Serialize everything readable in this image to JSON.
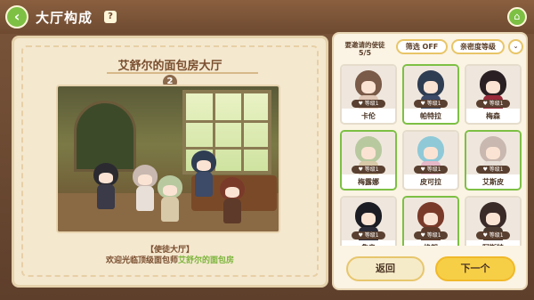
{
  "header": {
    "title": "大厅构成",
    "help_icon": "info-icon",
    "home_icon": "home-icon",
    "back_icon": "chevron-left-icon"
  },
  "left": {
    "hall_name": "艾舒尔的面包房大厅",
    "hall_number": "2",
    "caption_line1": "【使徒大厅】",
    "caption_prefix": "欢迎光临顶级面包师",
    "caption_highlight": "艾舒尔的面包房"
  },
  "right": {
    "invite_label": "要邀请的使徒",
    "invite_count": "5/5",
    "filter_label": "筛选 OFF",
    "sort_label": "亲密度等级",
    "expand_icon": "double-chevron-down-icon",
    "level_text": "等级1",
    "characters": [
      {
        "name": "卡伦",
        "selected": false,
        "hair": "#7a5a48",
        "outfit": "#e0c6b4"
      },
      {
        "name": "帕特拉",
        "selected": true,
        "hair": "#2f3d52",
        "outfit": "#3d4a68"
      },
      {
        "name": "梅森",
        "selected": false,
        "hair": "#2a1f22",
        "outfit": "#9a2a3a"
      },
      {
        "name": "梅露娜",
        "selected": true,
        "hair": "#b8c9a0",
        "outfit": "#d8c9a8"
      },
      {
        "name": "皮可拉",
        "selected": false,
        "hair": "#8fc9d8",
        "outfit": "#e5b8c8"
      },
      {
        "name": "艾斯皮",
        "selected": true,
        "hair": "#c9b8b0",
        "outfit": "#e8e0d8"
      },
      {
        "name": "詹奥",
        "selected": false,
        "hair": "#1c1c24",
        "outfit": "#2c2c38"
      },
      {
        "name": "格朗",
        "selected": true,
        "hair": "#7a3a2a",
        "outfit": "#5e3a2a"
      },
      {
        "name": "阿斯特",
        "selected": false,
        "hair": "#3a2a28",
        "outfit": "#4a3a30"
      }
    ],
    "back_button": "返回",
    "next_button": "下一个"
  }
}
